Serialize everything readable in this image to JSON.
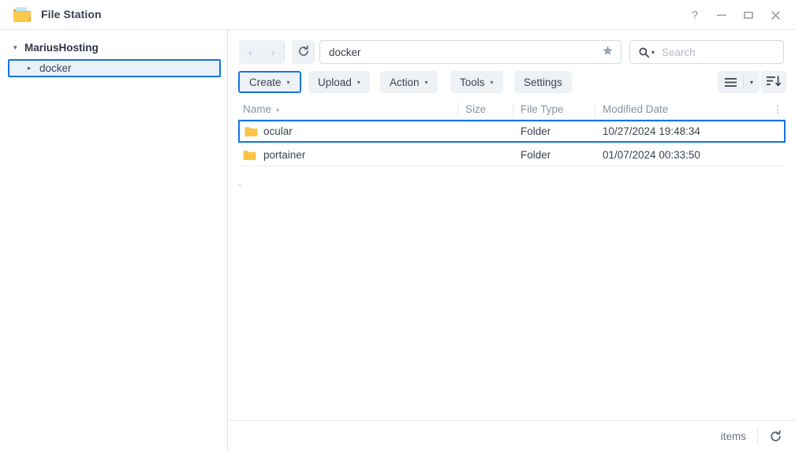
{
  "window": {
    "title": "File Station",
    "app_icon": "folder-icon",
    "controls": {
      "help": "?",
      "minimize": "—",
      "maximize": "▭",
      "close": "✕"
    }
  },
  "sidebar": {
    "root": {
      "label": "MariusHosting",
      "caret": "▾"
    },
    "items": [
      {
        "label": "docker",
        "caret": "▸",
        "selected": true
      }
    ]
  },
  "toolbar": {
    "nav": {
      "back": "‹",
      "forward": "›",
      "refresh": "refresh-icon"
    },
    "path": {
      "value": "docker",
      "favorite_icon": "star-icon"
    },
    "search": {
      "placeholder": "Search",
      "value": "",
      "icon": "search-icon",
      "caret": "▾"
    },
    "buttons": [
      {
        "label": "Create",
        "caret": "▾",
        "focused": true
      },
      {
        "label": "Upload",
        "caret": "▾",
        "focused": false
      },
      {
        "label": "Action",
        "caret": "▾",
        "focused": false
      },
      {
        "label": "Tools",
        "caret": "▾",
        "focused": false
      },
      {
        "label": "Settings",
        "caret": "",
        "focused": false
      }
    ],
    "view": {
      "list_icon": "list-view-icon",
      "caret": "▾",
      "sort_icon": "sort-descending-icon"
    }
  },
  "table": {
    "columns": [
      {
        "key": "name",
        "label": "Name",
        "sort": "▴"
      },
      {
        "key": "size",
        "label": "Size",
        "sort": ""
      },
      {
        "key": "filetype",
        "label": "File Type",
        "sort": ""
      },
      {
        "key": "modified",
        "label": "Modified Date",
        "sort": ""
      }
    ],
    "options_icon": "⋮",
    "rows": [
      {
        "icon": "folder-icon",
        "name": "ocular",
        "size": "",
        "filetype": "Folder",
        "modified": "10/27/2024 19:48:34",
        "selected": true
      },
      {
        "icon": "folder-icon",
        "name": "portainer",
        "size": "",
        "filetype": "Folder",
        "modified": "01/07/2024 00:33:50",
        "selected": false
      }
    ]
  },
  "statusbar": {
    "items_label": "items",
    "refresh_icon": "refresh-icon"
  },
  "colors": {
    "accent": "#1573e6",
    "folder": "#fcc444",
    "toolbar_button_bg": "#eef2f7",
    "text": "#3c4450",
    "muted_text": "#8a93a0"
  }
}
